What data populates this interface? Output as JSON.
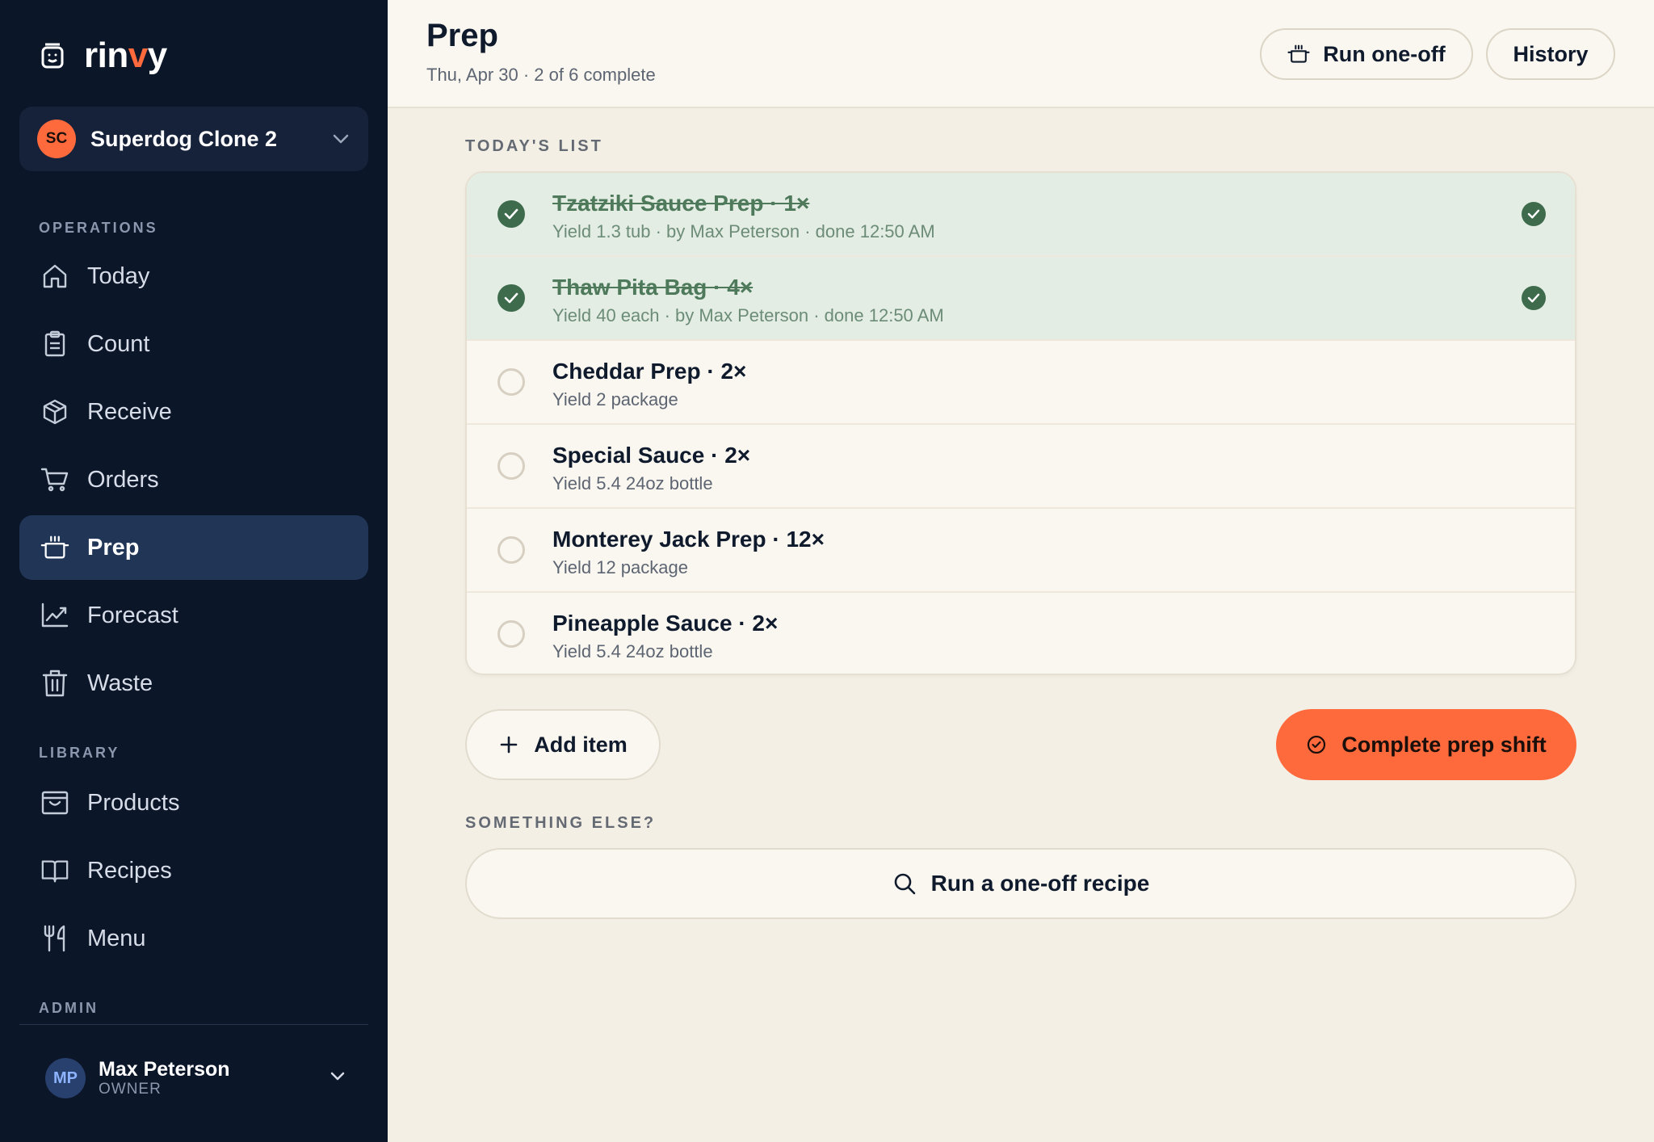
{
  "brand": {
    "name_prefix": "rin",
    "name_accent": "v",
    "name_suffix": "y",
    "icon": "jar-icon"
  },
  "store": {
    "initials": "SC",
    "name": "Superdog Clone 2"
  },
  "sidebar": {
    "operations_label": "OPERATIONS",
    "operations": [
      {
        "label": "Today",
        "icon": "home-icon"
      },
      {
        "label": "Count",
        "icon": "clipboard-icon"
      },
      {
        "label": "Receive",
        "icon": "box-icon"
      },
      {
        "label": "Orders",
        "icon": "cart-icon"
      },
      {
        "label": "Prep",
        "icon": "pot-icon",
        "active": true
      },
      {
        "label": "Forecast",
        "icon": "chart-icon"
      },
      {
        "label": "Waste",
        "icon": "trash-icon"
      }
    ],
    "library_label": "LIBRARY",
    "library": [
      {
        "label": "Products",
        "icon": "product-box-icon"
      },
      {
        "label": "Recipes",
        "icon": "book-icon"
      },
      {
        "label": "Menu",
        "icon": "utensils-icon"
      }
    ],
    "admin_label": "ADMIN"
  },
  "user": {
    "initials": "MP",
    "name": "Max Peterson",
    "role": "OWNER"
  },
  "header": {
    "title": "Prep",
    "subtitle": "Thu, Apr 30 · 2 of 6 complete",
    "run_oneoff_label": "Run one-off",
    "history_label": "History"
  },
  "todays_list_label": "TODAY'S LIST",
  "items": [
    {
      "title": "Tzatziki Sauce Prep · 1×",
      "subtitle": "Yield 1.3 tub · by Max Peterson · done 12:50 AM",
      "done": true
    },
    {
      "title": "Thaw Pita Bag · 4×",
      "subtitle": "Yield 40 each · by Max Peterson · done 12:50 AM",
      "done": true
    },
    {
      "title": "Cheddar Prep · 2×",
      "subtitle": "Yield 2 package",
      "done": false
    },
    {
      "title": "Special Sauce · 2×",
      "subtitle": "Yield 5.4 24oz bottle",
      "done": false
    },
    {
      "title": "Monterey Jack Prep · 12×",
      "subtitle": "Yield 12 package",
      "done": false
    },
    {
      "title": "Pineapple Sauce · 2×",
      "subtitle": "Yield 5.4 24oz bottle",
      "done": false
    }
  ],
  "actions": {
    "add_item_label": "Add item",
    "complete_label": "Complete prep shift"
  },
  "something_else_label": "SOMETHING ELSE?",
  "oneoff_recipe_label": "Run a one-off recipe",
  "colors": {
    "accent": "#ff6a3d",
    "sidebar_bg": "#0c1629",
    "done_green": "#3e6b4c",
    "page_bg": "#f4efe5"
  }
}
